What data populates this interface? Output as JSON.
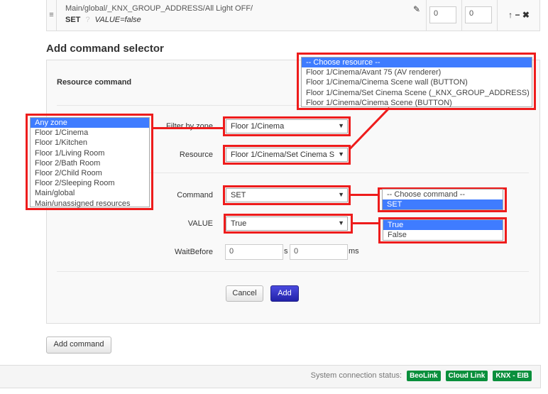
{
  "command_row": {
    "path": "Main/global/_KNX_GROUP_ADDRESS/All Light OFF/",
    "command": "SET",
    "help": "?",
    "params": "VALUE=false",
    "input1": "0",
    "input2": "0"
  },
  "heading": "Add command selector",
  "form": {
    "section_label": "Resource command",
    "filter_label": "Filter by zone",
    "filter_value": "Floor 1/Cinema",
    "resource_label": "Resource",
    "resource_value": "Floor 1/Cinema/Set Cinema S",
    "command_label": "Command",
    "command_value": "SET",
    "value_label": "VALUE",
    "value_value": "True",
    "wait_label": "WaitBefore",
    "wait_s": "0",
    "wait_s_unit": "s",
    "wait_ms": "0",
    "wait_ms_unit": "ms",
    "cancel": "Cancel",
    "add": "Add"
  },
  "resource_options": [
    "-- Choose resource --",
    "Floor 1/Cinema/Avant 75 (AV renderer)",
    "Floor 1/Cinema/Cinema Scene wall (BUTTON)",
    "Floor 1/Cinema/Set Cinema Scene (_KNX_GROUP_ADDRESS)",
    "Floor 1/Cinema/Cinema Scene (BUTTON)"
  ],
  "zone_options": [
    "Any zone",
    "Floor 1/Cinema",
    "Floor 1/Kitchen",
    "Floor 1/Living Room",
    "Floor 2/Bath Room",
    "Floor 2/Child Room",
    "Floor 2/Sleeping Room",
    "Main/global",
    "Main/unassigned resources"
  ],
  "command_options": [
    "-- Choose command --",
    "SET"
  ],
  "value_options": [
    "True",
    "False"
  ],
  "add_command": "Add command",
  "footer": {
    "status_label": "System connection status:",
    "badges": [
      "BeoLink",
      "Cloud Link",
      "KNX - EIB"
    ],
    "badge_color": "#0a8f3c"
  },
  "colors": {
    "highlight": "#ee1c1c",
    "selected": "#3f7cff"
  }
}
